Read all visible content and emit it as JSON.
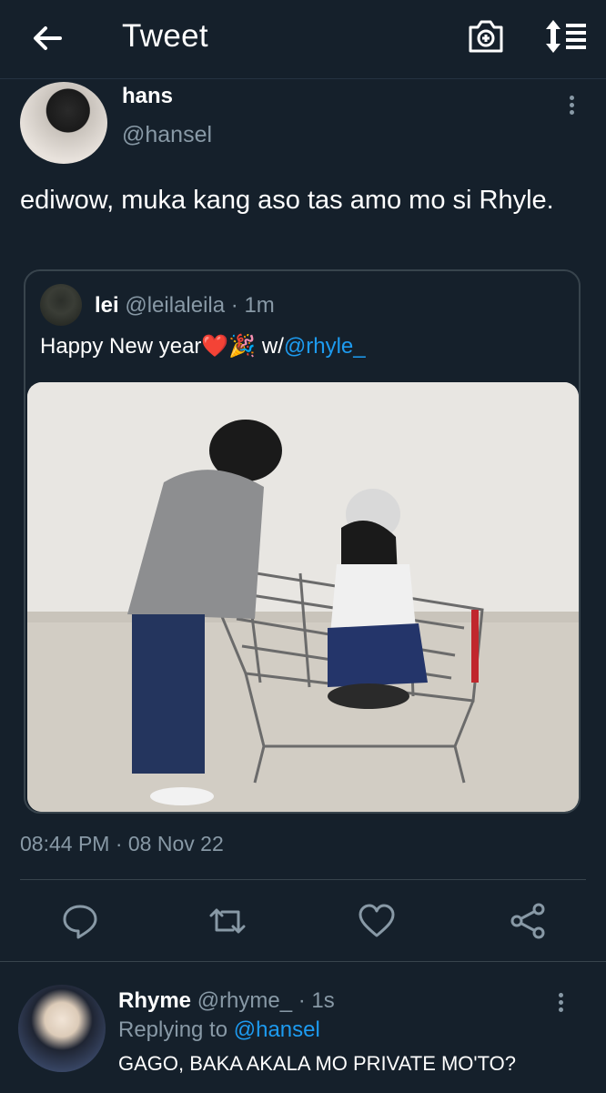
{
  "header": {
    "title": "Tweet",
    "back_icon": "arrow-left-icon",
    "camera_icon": "camera-add-icon",
    "sort_icon": "sort-icon"
  },
  "tweet": {
    "author_name": "hans",
    "author_handle": "@hansel",
    "text": "ediwow, muka kang aso tas amo mo si Rhyle.",
    "timestamp": "08:44 PM · 08 Nov 22"
  },
  "quote": {
    "name": "lei",
    "handle": "@leilaleila",
    "time": "· 1m",
    "text_prefix": "Happy New year",
    "heart": "❤️",
    "party": "🎉",
    "text_with": " w/",
    "mention": "@rhyle_"
  },
  "actions": [
    {
      "icon": "reply-icon"
    },
    {
      "icon": "retweet-icon"
    },
    {
      "icon": "like-icon"
    },
    {
      "icon": "share-icon"
    }
  ],
  "reply": {
    "name": "Rhyme",
    "handle": "@rhyme_",
    "time": "· 1s",
    "replying_prefix": "Replying to ",
    "replying_handle": "@hansel",
    "text": "GAGO, BAKA AKALA MO PRIVATE MO'TO?"
  },
  "colors": {
    "background": "#15202b",
    "accent": "#1d9bf0",
    "secondary_text": "#8899a6",
    "border": "#38444d"
  }
}
